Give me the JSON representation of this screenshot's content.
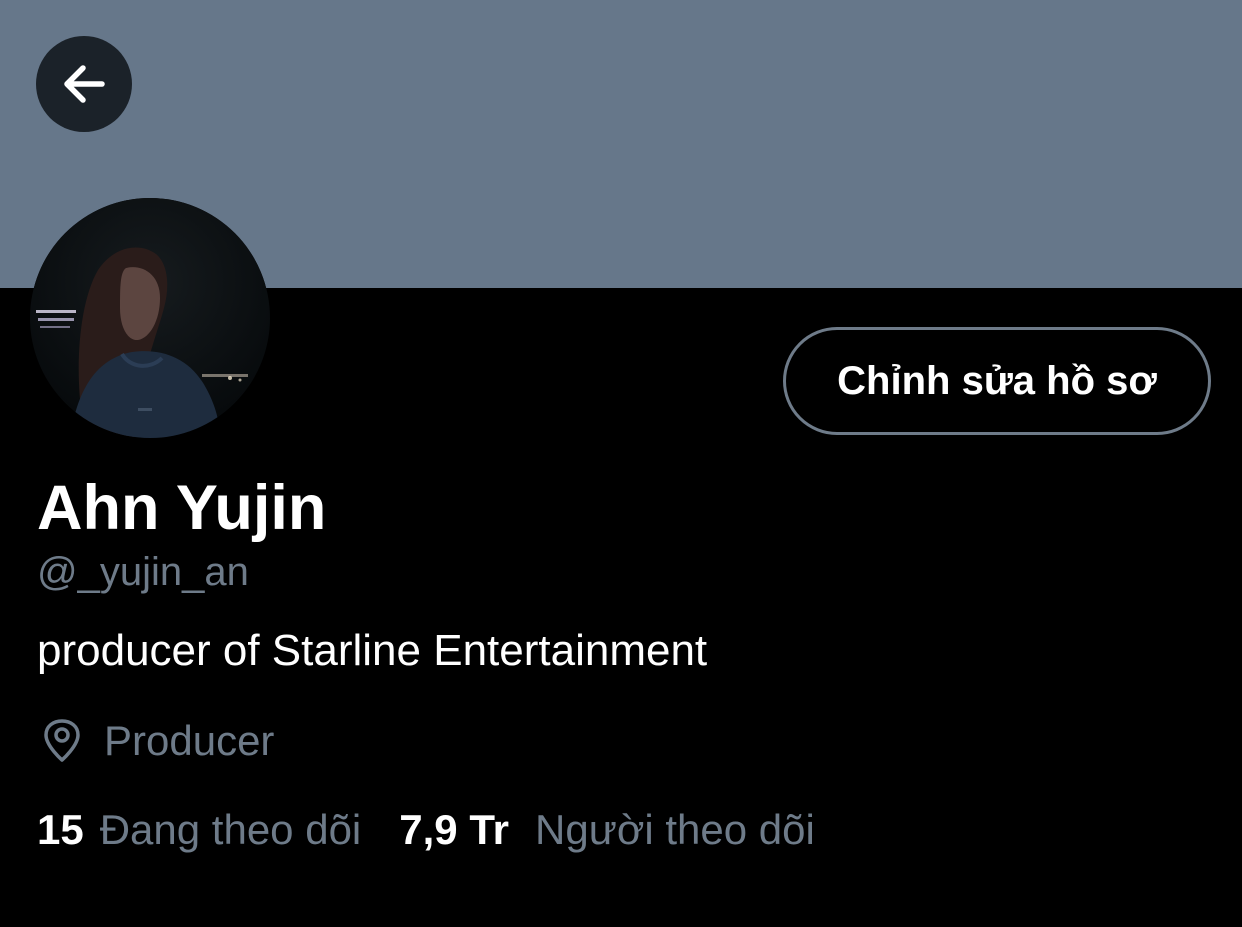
{
  "header": {
    "back_icon": "arrow-left-icon",
    "banner_color": "#66778a"
  },
  "profile": {
    "avatar_alt": "avatar",
    "edit_button_label": "Chỉnh sửa hồ sơ",
    "display_name": "Ahn Yujin",
    "handle": "@_yujin_an",
    "bio": "producer of Starline Entertainment",
    "location_icon": "location-pin-icon",
    "location": "Producer"
  },
  "stats": {
    "following_count": "15",
    "following_label": "Đang theo dõi",
    "followers_count": "7,9 Tr",
    "followers_label": "Người theo dõi"
  },
  "colors": {
    "background": "#000000",
    "primary_text": "#ffffff",
    "secondary_text": "#6e7b89",
    "button_border": "#6e7b89"
  }
}
